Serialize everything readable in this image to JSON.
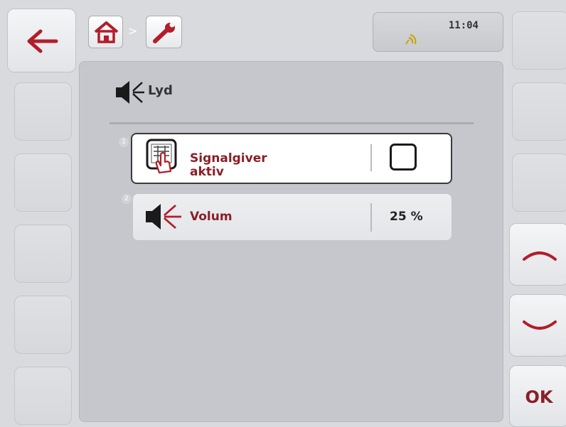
{
  "header": {
    "back_icon": "arrow-left-icon",
    "breadcrumb": [
      {
        "icon": "home-icon"
      },
      {
        "icon": "wrench-icon"
      }
    ],
    "breadcrumb_separator": ">",
    "clock": "11:04",
    "status_icon": "signal-icon"
  },
  "section": {
    "icon": "speaker-icon",
    "title": "Lyd"
  },
  "rows": [
    {
      "number": "1",
      "icon": "touch-panel-icon",
      "label_line1": "Signalgiver",
      "label_line2": "aktiv",
      "checked": false
    },
    {
      "number": "2",
      "icon": "speaker-icon",
      "label": "Volum",
      "value": "25 %"
    }
  ],
  "right_buttons": {
    "up_icon": "chevron-up-icon",
    "down_icon": "chevron-down-icon",
    "ok_label": "OK"
  },
  "colors": {
    "accent": "#8a1f28",
    "background": "#d9dadd",
    "panel": "#c5c7cc"
  }
}
